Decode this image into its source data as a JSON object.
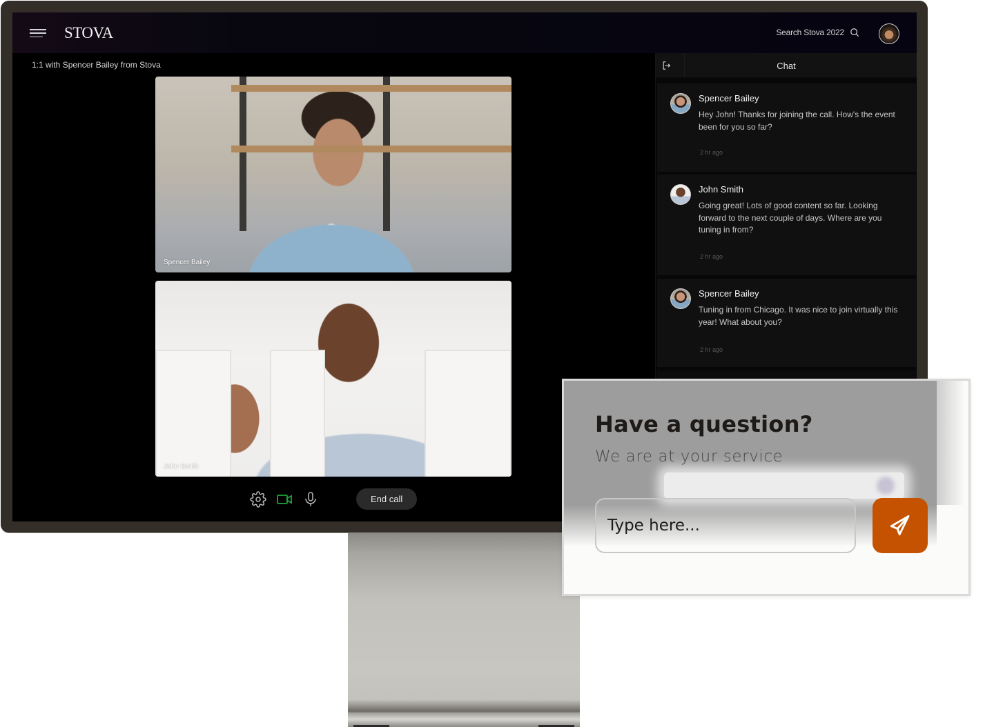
{
  "app": {
    "logo": "STOVA",
    "search_label": "Search Stova 2022",
    "icons": {
      "menu": "hamburger-icon",
      "search": "search-icon",
      "avatar": "user-avatar"
    }
  },
  "call": {
    "title": "1:1 with Spencer Bailey from Stova",
    "participants": [
      {
        "name": "Spencer Bailey"
      },
      {
        "name": "John Smith"
      }
    ],
    "controls": {
      "settings_icon": "gear-icon",
      "camera_icon": "video-camera-icon",
      "mic_icon": "microphone-icon",
      "end_call_label": "End call"
    },
    "colors": {
      "camera_active": "#1fa53a",
      "end_call_bg": "#2a2a2a"
    }
  },
  "chat": {
    "title": "Chat",
    "exit_icon": "exit-icon",
    "messages": [
      {
        "author": "Spencer Bailey",
        "text": "Hey John! Thanks for joining the call. How's the event been for you so far?",
        "time": "2 hr ago"
      },
      {
        "author": "John Smith",
        "text": "Going great! Lots of good content so far. Looking forward to the next couple of days. Where are you tuning in from?",
        "time": "2 hr ago"
      },
      {
        "author": "Spencer Bailey",
        "text": "Tuning in from Chicago. It was nice to join virtually this year! What about you?",
        "time": "2 hr ago"
      }
    ]
  },
  "question_card": {
    "headline": "Have a question?",
    "subheadline": "We are at your service",
    "input_placeholder": "Type here...",
    "input_value": "",
    "send_icon": "paper-plane-icon",
    "accent_color": "#c45200"
  }
}
